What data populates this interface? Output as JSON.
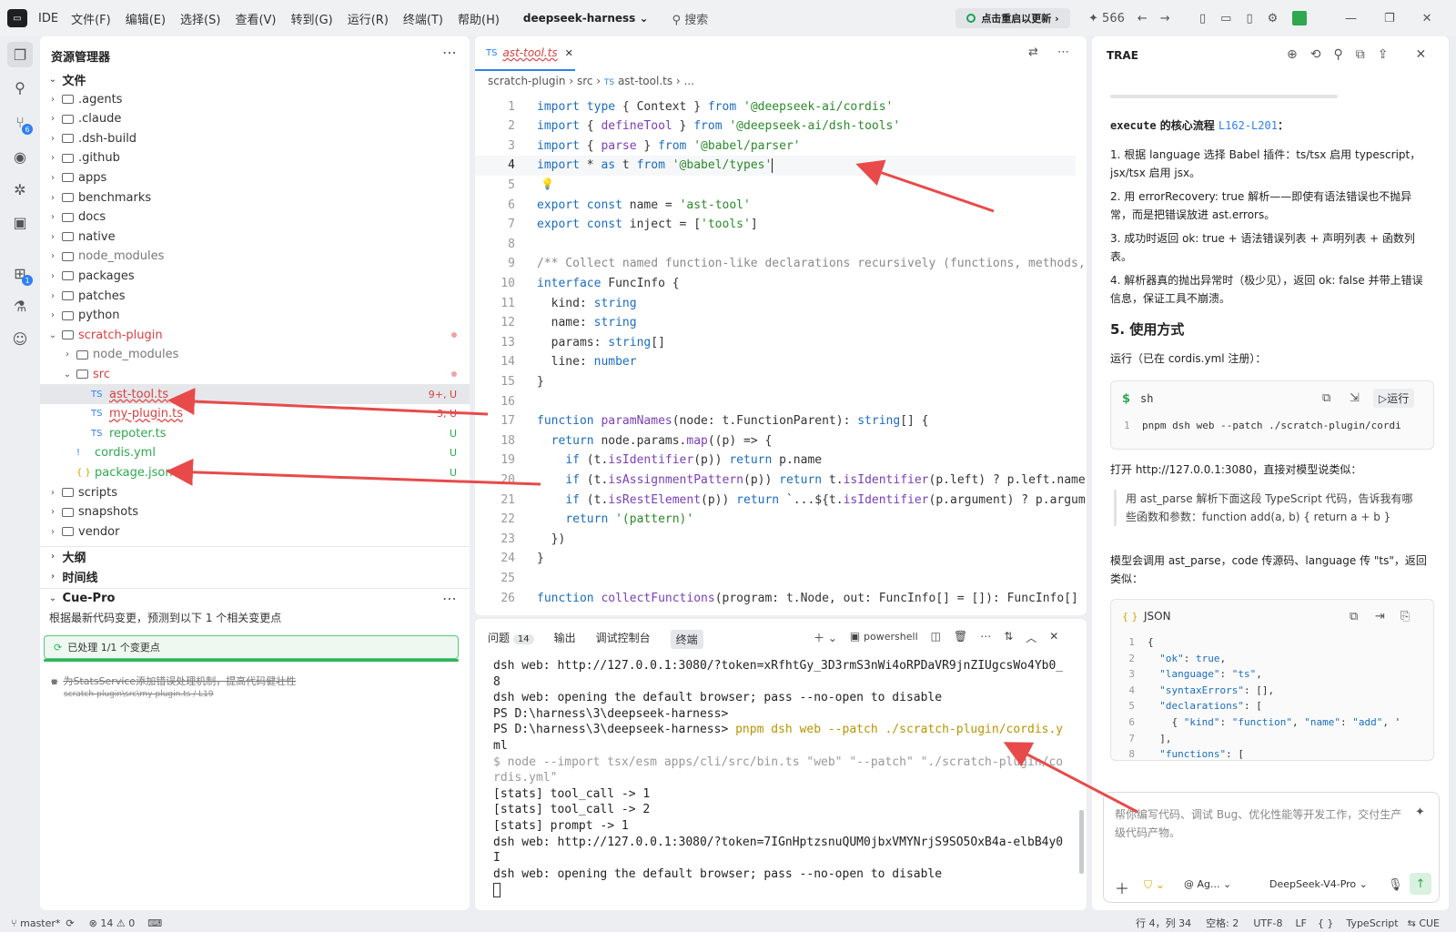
{
  "titlebar": {
    "ide_label": "IDE",
    "menus": [
      "文件(F)",
      "编辑(E)",
      "选择(S)",
      "查看(V)",
      "转到(G)",
      "运行(R)",
      "终端(T)",
      "帮助(H)"
    ],
    "project": "deepseek-harness",
    "search": "搜索",
    "restart": "点击重启以更新",
    "stars": "566"
  },
  "explorer": {
    "title": "资源管理器",
    "section_files": "文件",
    "items": [
      {
        "label": ".agents"
      },
      {
        "label": ".claude"
      },
      {
        "label": ".dsh-build"
      },
      {
        "label": ".github"
      },
      {
        "label": "apps"
      },
      {
        "label": "benchmarks"
      },
      {
        "label": "docs"
      },
      {
        "label": "native"
      },
      {
        "label": "node_modules"
      },
      {
        "label": "packages"
      },
      {
        "label": "patches"
      },
      {
        "label": "python"
      },
      {
        "label": "scratch-plugin"
      },
      {
        "label": "node_modules"
      },
      {
        "label": "src"
      },
      {
        "label": "ast-tool.ts",
        "status": "9+, U"
      },
      {
        "label": "my-plugin.ts",
        "status": "3, U"
      },
      {
        "label": "repoter.ts",
        "status": "U"
      },
      {
        "label": "cordis.yml",
        "status": "U"
      },
      {
        "label": "package.json",
        "status": "U"
      },
      {
        "label": "scripts"
      },
      {
        "label": "snapshots"
      },
      {
        "label": "vendor"
      }
    ],
    "file_type_ts": "TS",
    "file_type_yml": "!",
    "file_type_json": "{ }",
    "section_outline": "大纲",
    "section_timeline": "时间线",
    "section_cue": "Cue-Pro",
    "cue_desc": "根据最新代码变更，预测到以下 1 个相关变更点",
    "cue_processed": "已处理 1/1 个变更点",
    "cue_item": "为StatsService添加错误处理机制，提高代码健壮性",
    "cue_item_path": "scratch-plugin\\src\\my-plugin.ts / L19"
  },
  "editor": {
    "tab_type": "TS",
    "tab_label": "ast-tool.ts",
    "crumb1": "scratch-plugin",
    "crumb2": "src",
    "crumb3_type": "TS",
    "crumb3": "ast-tool.ts",
    "crumb4": "...",
    "lines": [
      "1",
      "2",
      "3",
      "4",
      "5",
      "6",
      "7",
      "8",
      "9",
      "10",
      "11",
      "12",
      "13",
      "14",
      "15",
      "16",
      "17",
      "18",
      "19",
      "20",
      "21",
      "22",
      "23",
      "24",
      "25",
      "26"
    ],
    "code": [
      "import type { Context } from '@deepseek-ai/cordis'",
      "import { defineTool } from '@deepseek-ai/dsh-tools'",
      "import { parse } from '@babel/parser'",
      "import * as t from '@babel/types'",
      "",
      "export const name = 'ast-tool'",
      "export const inject = ['tools']",
      "",
      "/** Collect named function-like declarations recursively (functions, methods,",
      "interface FuncInfo {",
      "  kind: string",
      "  name: string",
      "  params: string[]",
      "  line: number",
      "}",
      "",
      "function paramNames(node: t.FunctionParent): string[] {",
      "  return node.params.map((p) => {",
      "    if (t.isIdentifier(p)) return p.name",
      "    if (t.isAssignmentPattern(p)) return t.isIdentifier(p.left) ? p.left.name",
      "    if (t.isRestElement(p)) return `...${t.isIdentifier(p.argument) ? p.argum",
      "    return '(pattern)'",
      "  })",
      "}",
      "",
      "function collectFunctions(program: t.Node, out: FuncInfo[] = []): FuncInfo[]"
    ]
  },
  "terminal": {
    "tab_problems": "问题",
    "problems_count": "14",
    "tab_output": "输出",
    "tab_debug": "调试控制台",
    "tab_terminal": "终端",
    "shell": "powershell",
    "lines": [
      "dsh web: http://127.0.0.1:3080/?token=xRfhtGy_3D3rmS3nWi4oRPDaVR9jnZIUgcsWo4Yb0_",
      "8",
      "dsh web: opening the default browser; pass --no-open to disable",
      "PS D:\\harness\\3\\deepseek-harness>",
      "PS D:\\harness\\3\\deepseek-harness> pnpm dsh web --patch ./scratch-plugin/cordis.y",
      "ml",
      "$ node --import tsx/esm apps/cli/src/bin.ts \"web\" \"--patch\" \"./scratch-plugin/co",
      "rdis.yml\"",
      "[stats] tool_call -> 1",
      "[stats] tool_call -> 2",
      "[stats] prompt -> 1",
      "dsh web: http://127.0.0.1:3080/?token=7IGnHptzsnuQUM0jbxVMYNrjS9SO5OxB4a-elbB4y0",
      "I",
      "dsh web: opening the default browser; pass --no-open to disable"
    ]
  },
  "right": {
    "title": "TRAE",
    "flow_heading_code": "execute",
    "flow_heading_text": " 的核心流程 ",
    "flow_range": "L162-L201",
    "flow_colon": "：",
    "step1": "1. 根据 language 选择 Babel 插件：ts/tsx 启用 typescript，jsx/tsx 启用 jsx。",
    "step2": "2. 用 errorRecovery: true 解析——即使有语法错误也不抛异常，而是把错误放进 ast.errors。",
    "step3": "3. 成功时返回 ok: true + 语法错误列表 + 声明列表 + 函数列表。",
    "step4": "4. 解析器真的抛出异常时（极少见），返回 ok: false 并带上错误信息，保证工具不崩溃。",
    "section5": "5. 使用方式",
    "run_text": "运行（已在 cordis.yml 注册）：",
    "sh_label": "sh",
    "run_btn": "▷运行",
    "sh_cmd": "pnpm dsh web --patch ./scratch-plugin/cordi",
    "open_text": "打开 http://127.0.0.1:3080，直接对模型说类似：",
    "quote": "用 ast_parse 解析下面这段 TypeScript 代码，告诉我有哪些函数和参数：function add(a, b) { return a + b }",
    "model_text": "模型会调用 ast_parse，code 传源码、language 传 \"ts\"，返回类似：",
    "json_label": "JSON",
    "json_lines": [
      "{",
      "  \"ok\": true,",
      "  \"language\": \"ts\",",
      "  \"syntaxErrors\": [],",
      "  \"declarations\": [",
      "    { \"kind\": \"function\", \"name\": \"add\", '",
      "  ],",
      "  \"functions\": ["
    ],
    "input_placeholder": "帮你编写代码、调试 Bug、优化性能等开发工作，交付生产级代码产物。",
    "agent": "@ Ag...",
    "model": "DeepSeek-V4-Pro"
  },
  "statusbar": {
    "branch": "master*",
    "errors": "14",
    "warnings": "0",
    "position": "行 4，列 34",
    "spaces": "空格: 2",
    "encoding": "UTF-8",
    "eol": "LF",
    "braces": "{ }",
    "lang": "TypeScript",
    "cue": "CUE"
  }
}
